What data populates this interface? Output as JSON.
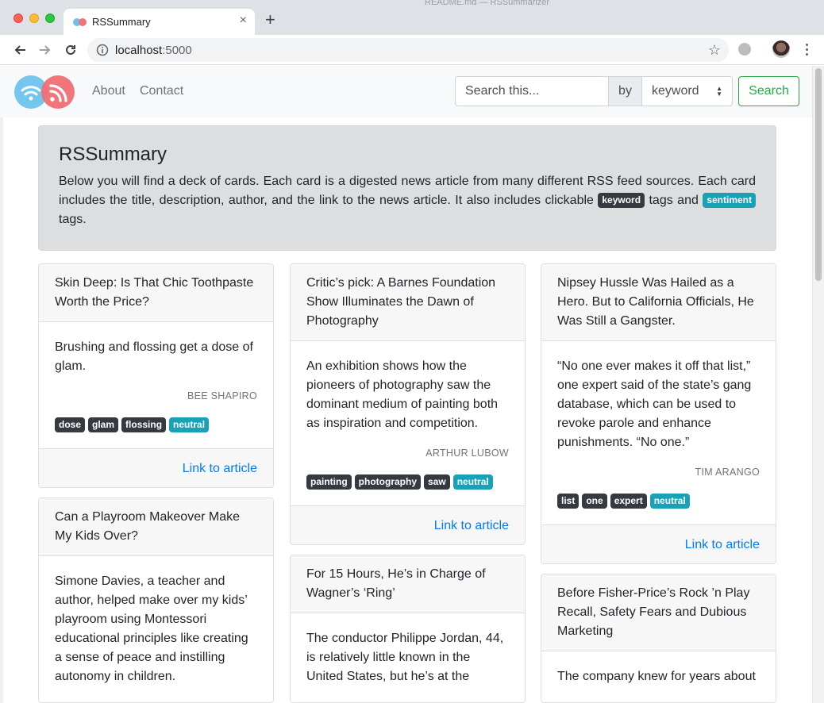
{
  "browser": {
    "background_tab_text": "README.md — RSSummarizer",
    "tab_title": "RSSummary",
    "tab_close": "×",
    "new_tab": "+",
    "url_host": "localhost",
    "url_port": ":5000",
    "bookmark_star": "☆"
  },
  "navbar": {
    "links": [
      "About",
      "Contact"
    ],
    "search_placeholder": "Search this...",
    "by_label": "by",
    "select_value": "keyword",
    "search_button": "Search"
  },
  "jumbotron": {
    "title": "RSSummary",
    "text_before_keyword": "Below you will find a deck of cards. Each card is a digested news article from many different RSS feed sources. Each card includes the title, description, author, and the link to the news article. It also includes clickable ",
    "keyword_badge": "keyword",
    "text_middle": " tags and ",
    "sentiment_badge": "sentiment",
    "text_end": " tags."
  },
  "link_label": "Link to article",
  "columns": [
    [
      {
        "title": "Skin Deep: Is That Chic Toothpaste Worth the Price?",
        "description": "Brushing and flossing get a dose of glam.",
        "author": "BEE SHAPIRO",
        "keywords": [
          "dose",
          "glam",
          "flossing"
        ],
        "sentiment": "neutral",
        "footer": true
      },
      {
        "title": "Can a Playroom Makeover Make My Kids Over?",
        "description": "Simone Davies, a teacher and author, helped make over my kids’ playroom using Montessori educational principles like creating a sense of peace and instilling autonomy in children.",
        "author": "",
        "keywords": [],
        "sentiment": "",
        "footer": false
      }
    ],
    [
      {
        "title": "Critic’s pick: A Barnes Foundation Show Illuminates the Dawn of Photography",
        "description": "An exhibition shows how the pioneers of photography saw the dominant medium of painting both as inspiration and competition.",
        "author": "ARTHUR LUBOW",
        "keywords": [
          "painting",
          "photography",
          "saw"
        ],
        "sentiment": "neutral",
        "footer": true
      },
      {
        "title": "For 15 Hours, He’s in Charge of Wagner’s ‘Ring’",
        "description": "The conductor Philippe Jordan, 44, is relatively little known in the United States, but he’s at the",
        "author": "",
        "keywords": [],
        "sentiment": "",
        "footer": false
      }
    ],
    [
      {
        "title": "Nipsey Hussle Was Hailed as a Hero. But to California Officials, He Was Still a Gangster.",
        "description": "“No one ever makes it off that list,” one expert said of the state’s gang database, which can be used to revoke parole and enhance punishments. “No one.”",
        "author": "TIM ARANGO",
        "keywords": [
          "list",
          "one",
          "expert"
        ],
        "sentiment": "neutral",
        "footer": true
      },
      {
        "title": "Before Fisher-Price’s Rock ’n Play Recall, Safety Fears and Dubious Marketing",
        "description": "The company knew for years about",
        "author": "",
        "keywords": [],
        "sentiment": "",
        "footer": false
      }
    ]
  ],
  "colors": {
    "badge_dark": "#343a40",
    "badge_info": "#17a2b8",
    "link": "#007bff",
    "search_green": "#28a745"
  }
}
